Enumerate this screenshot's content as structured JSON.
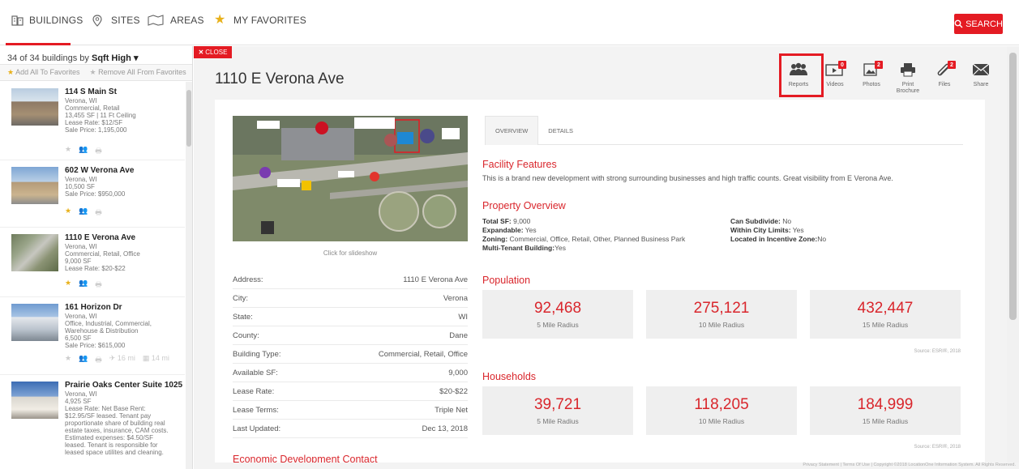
{
  "nav": {
    "tabs": [
      {
        "label": "BUILDINGS",
        "icon": "buildings-icon"
      },
      {
        "label": "SITES",
        "icon": "pin-icon"
      },
      {
        "label": "AREAS",
        "icon": "map-icon"
      },
      {
        "label": "MY FAVORITES",
        "icon": "star-icon"
      }
    ],
    "search_label": "SEARCH"
  },
  "sidebar": {
    "count_text": "34 of 34 buildings by",
    "sort_label": "Sqft High",
    "add_fav": "Add All To Favorites",
    "remove_fav": "Remove All From Favorites",
    "items": [
      {
        "title": "114 S Main St",
        "meta": "Verona, WI\nCommercial, Retail\n13,455 SF | 11 Ft Ceiling\nLease Rate: $12/SF\nSale Price: 1,195,000"
      },
      {
        "title": "602 W Verona Ave",
        "meta": "Verona, WI\n10,500 SF\nSale Price: $950,000"
      },
      {
        "title": "1110 E Verona Ave",
        "meta": "Verona, WI\nCommercial, Retail, Office\n9,000 SF\nLease Rate: $20-$22"
      },
      {
        "title": "161 Horizon Dr",
        "meta": "Verona, WI\nOffice, Industrial, Commercial,\nWarehouse & Distribution\n6,500 SF\nSale Price: $615,000",
        "distances": [
          "16 mi",
          "14 mi"
        ]
      },
      {
        "title": "Prairie Oaks Center Suite 1025",
        "meta": "Verona, WI\n4,925 SF\nLease Rate: Net Base Rent:\n$12.95/SF leased. Tenant pay\nproportionate share of building real\nestate taxes, insurance, CAM costs.\nEstimated expenses: $4.50/SF\nleased. Tenant is responsible for\nleased space utilites and cleaning."
      }
    ]
  },
  "detail": {
    "close_label": "CLOSE",
    "title": "1110 E Verona Ave",
    "tools": [
      {
        "label": "Reports",
        "badge": ""
      },
      {
        "label": "Videos",
        "badge": "0"
      },
      {
        "label": "Photos",
        "badge": "2"
      },
      {
        "label": "Print Brochure",
        "badge": ""
      },
      {
        "label": "Files",
        "badge": "2"
      },
      {
        "label": "Share",
        "badge": ""
      }
    ],
    "slideshow_label": "Click for slideshow",
    "facts": [
      {
        "k": "Address:",
        "v": "1110 E Verona Ave"
      },
      {
        "k": "City:",
        "v": "Verona"
      },
      {
        "k": "State:",
        "v": "WI"
      },
      {
        "k": "County:",
        "v": "Dane"
      },
      {
        "k": "Building Type:",
        "v": "Commercial, Retail, Office"
      },
      {
        "k": "Available SF:",
        "v": "9,000"
      },
      {
        "k": "Lease Rate:",
        "v": "$20-$22"
      },
      {
        "k": "Lease Terms:",
        "v": "Triple Net"
      },
      {
        "k": "Last Updated:",
        "v": "Dec 13, 2018"
      }
    ],
    "econ_contact": "Economic Development Contact",
    "tabs": [
      "OVERVIEW",
      "DETAILS"
    ],
    "facility_title": "Facility Features",
    "facility_text": "This is a brand new development with strong surrounding businesses and high traffic counts. Great visibility from E Verona Ave.",
    "property_title": "Property Overview",
    "property": {
      "total_sf_k": "Total SF:",
      "total_sf_v": "9,000",
      "expandable_k": "Expandable:",
      "expandable_v": "Yes",
      "zoning_k": "Zoning:",
      "zoning_v": "Commercial, Office, Retail, Other, Planned Business Park",
      "multi_k": "Multi-Tenant Building:",
      "multi_v": "Yes",
      "subdivide_k": "Can Subdivide:",
      "subdivide_v": "No",
      "city_k": "Within City Limits:",
      "city_v": "Yes",
      "incentive_k": "Located in Incentive Zone:",
      "incentive_v": "No"
    },
    "population_title": "Population",
    "population": [
      {
        "num": "92,468",
        "lbl": "5 Mile Radius"
      },
      {
        "num": "275,121",
        "lbl": "10 Mile Radius"
      },
      {
        "num": "432,447",
        "lbl": "15 Mile Radius"
      }
    ],
    "households_title": "Households",
    "households": [
      {
        "num": "39,721",
        "lbl": "5 Mile Radius"
      },
      {
        "num": "118,205",
        "lbl": "10 Mile Radius"
      },
      {
        "num": "184,999",
        "lbl": "15 Mile Radius"
      }
    ],
    "source": "Source: ESRI®, 2018"
  },
  "footer": "Privacy Statement  |  Terms Of Use  |  Copyright ©2018 LocationOne Information System. All Rights Reserved.",
  "colors": {
    "accent": "#e41b23",
    "heading": "#d9262c",
    "star": "#e8b11b"
  }
}
